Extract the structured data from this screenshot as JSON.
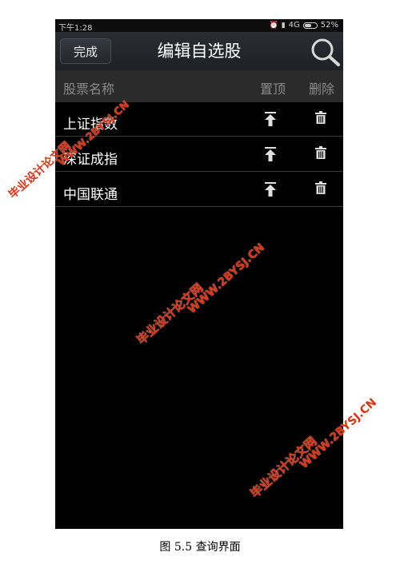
{
  "status_bar": {
    "time": "下午1:28",
    "network": "4G",
    "battery": "52%"
  },
  "header": {
    "done_label": "完成",
    "title": "编辑自选股",
    "search_icon": "search-icon"
  },
  "columns": {
    "name": "股票名称",
    "top": "置顶",
    "delete": "删除"
  },
  "stocks": [
    {
      "name": "上证指数"
    },
    {
      "name": "深证成指"
    },
    {
      "name": "中国联通"
    }
  ],
  "watermark": {
    "cn": "毕业设计论文网",
    "url": "WWW.2BYSJ.CN"
  },
  "caption": "图 5.5 查询界面",
  "colors": {
    "background": "#000000",
    "header": "#24282c",
    "column_header": "#2b2b2b",
    "watermark": "#e03010"
  }
}
